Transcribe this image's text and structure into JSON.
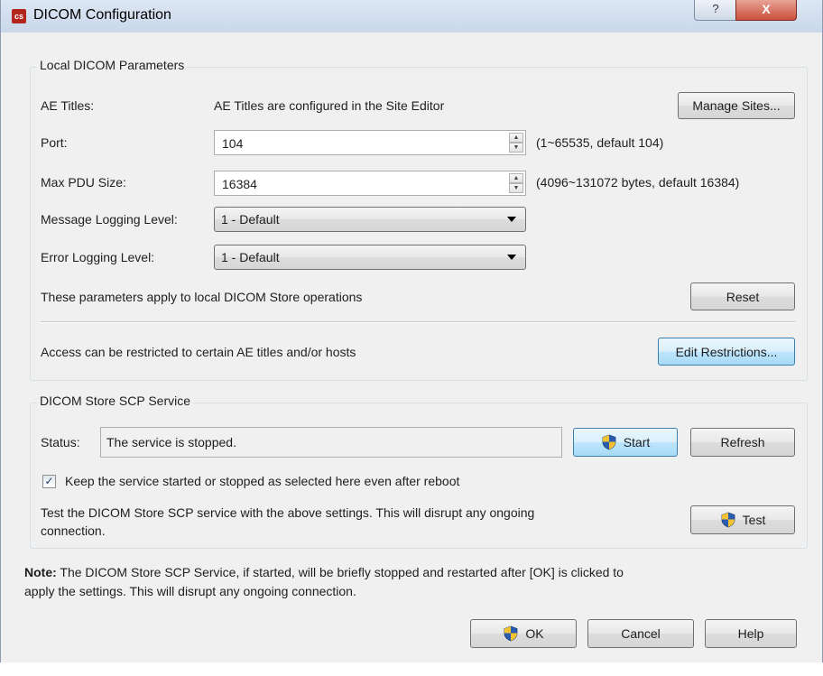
{
  "window": {
    "title": "DICOM Configuration",
    "app_icon_text": "cs",
    "help_label": "?",
    "close_label": "X"
  },
  "local": {
    "group_title": "Local DICOM Parameters",
    "ae_titles_label": "AE Titles:",
    "ae_titles_text": "AE Titles are configured in the Site Editor",
    "manage_sites_label": "Manage Sites...",
    "port_label": "Port:",
    "port_value": "104",
    "port_hint": "(1~65535, default 104)",
    "max_pdu_label": "Max PDU Size:",
    "max_pdu_value": "16384",
    "max_pdu_hint": "(4096~131072 bytes, default 16384)",
    "message_logging_label": "Message Logging Level:",
    "message_logging_value": "1 - Default",
    "error_logging_label": "Error Logging Level:",
    "error_logging_value": "1 - Default",
    "params_note": "These parameters apply to local DICOM Store operations",
    "reset_label": "Reset",
    "access_note": "Access can be restricted to certain AE titles and/or hosts",
    "edit_restrictions_label": "Edit Restrictions..."
  },
  "scp": {
    "group_title": "DICOM Store SCP Service",
    "status_label": "Status:",
    "status_value": "The service is stopped.",
    "start_label": "Start",
    "refresh_label": "Refresh",
    "keep_label": "Keep the service started or stopped as selected here even after reboot",
    "keep_checked": true,
    "test_note_line1": "Test the DICOM Store SCP service with the above settings. This will disrupt any ongoing",
    "test_note_line2": "connection.",
    "test_label": "Test"
  },
  "note": {
    "bold": "Note:",
    "line1": " The DICOM Store SCP Service, if started, will be briefly stopped and restarted after [OK] is clicked to",
    "line2": "apply the settings. This will disrupt any ongoing connection."
  },
  "footer": {
    "ok_label": "OK",
    "cancel_label": "Cancel",
    "help_label": "Help"
  },
  "colors": {
    "shield_blue": "#2a5db0",
    "shield_yellow": "#f2c230",
    "focus_border": "#3c7fb1"
  }
}
